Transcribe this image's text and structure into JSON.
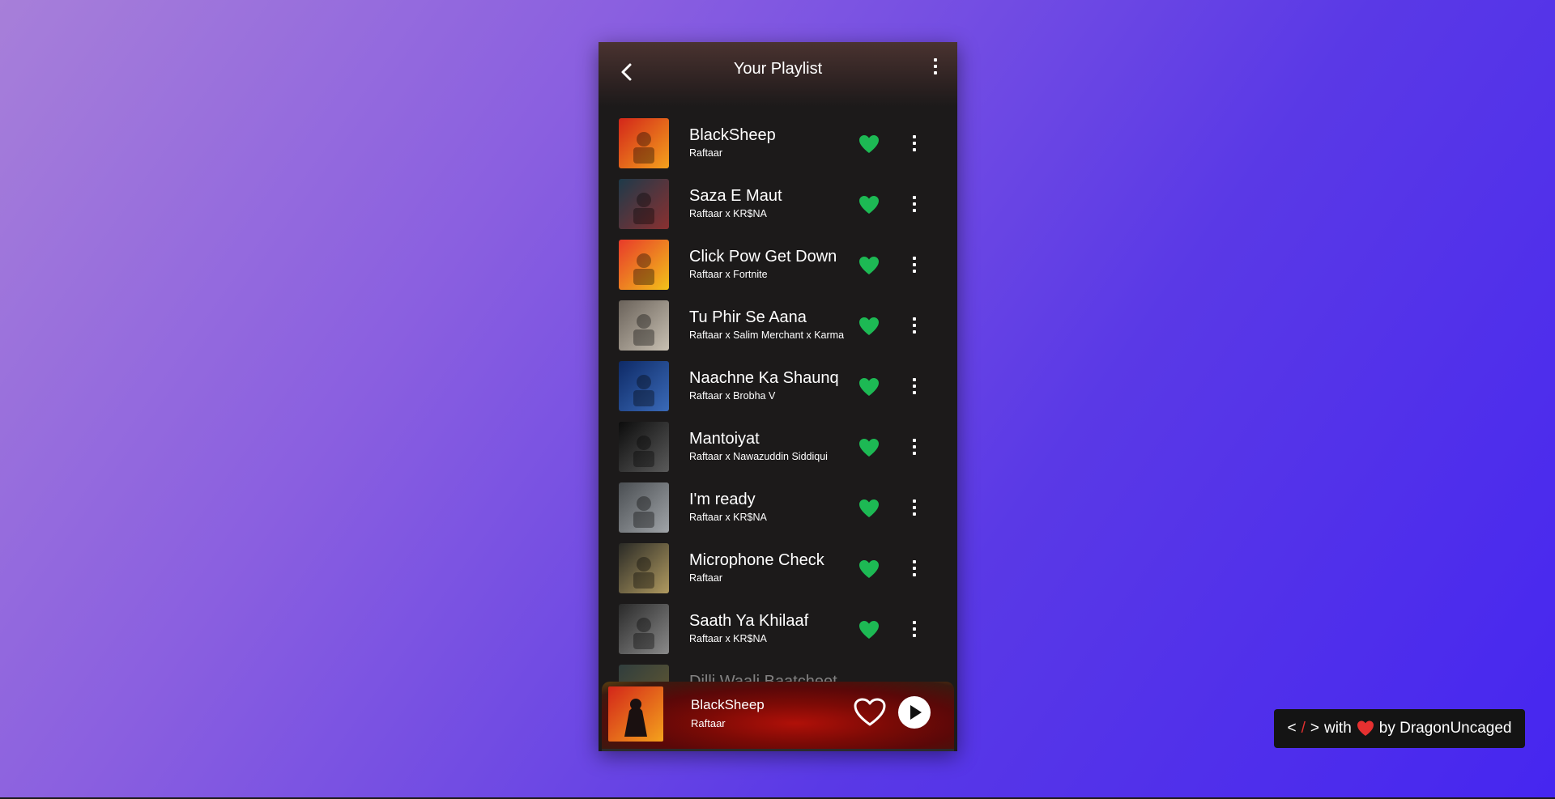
{
  "header": {
    "title": "Your Playlist",
    "back_icon": "chevron-left-icon",
    "more_icon": "more-vertical-icon"
  },
  "songs": [
    {
      "title": "BlackSheep",
      "artist": "Raftaar",
      "liked": true,
      "cover_colors": [
        "#d3261a",
        "#f4a21c"
      ]
    },
    {
      "title": "Saza E Maut",
      "artist": "Raftaar x KR$NA",
      "liked": true,
      "cover_colors": [
        "#1e3a4a",
        "#8a3030"
      ]
    },
    {
      "title": "Click Pow Get Down",
      "artist": "Raftaar x Fortnite",
      "liked": true,
      "cover_colors": [
        "#e83a2a",
        "#f2c21a"
      ]
    },
    {
      "title": "Tu Phir Se Aana",
      "artist": "Raftaar x Salim Merchant x Karma",
      "liked": true,
      "cover_colors": [
        "#6a625a",
        "#c8c0b2"
      ]
    },
    {
      "title": "Naachne Ka Shaunq",
      "artist": "Raftaar x Brobha V",
      "liked": true,
      "cover_colors": [
        "#0e2a66",
        "#3a6ab8"
      ]
    },
    {
      "title": "Mantoiyat",
      "artist": "Raftaar x Nawazuddin Siddiqui",
      "liked": true,
      "cover_colors": [
        "#0c0c0c",
        "#5a5a5a"
      ]
    },
    {
      "title": "I'm ready",
      "artist": "Raftaar x KR$NA",
      "liked": true,
      "cover_colors": [
        "#4a4e52",
        "#a0a4a8"
      ]
    },
    {
      "title": "Microphone Check",
      "artist": "Raftaar",
      "liked": true,
      "cover_colors": [
        "#2a2a26",
        "#b09a60"
      ]
    },
    {
      "title": "Saath Ya Khilaaf",
      "artist": "Raftaar x KR$NA",
      "liked": true,
      "cover_colors": [
        "#2a2a2a",
        "#8a8a8a"
      ]
    }
  ],
  "partial_row": {
    "title": "Dilli Waali Baatcheet",
    "cover_colors": [
      "#4a6a6a",
      "#c2a84a"
    ]
  },
  "player": {
    "title": "BlackSheep",
    "artist": "Raftaar",
    "heart_icon": "heart-outline-icon",
    "play_icon": "play-icon"
  },
  "credit": {
    "open": "<",
    "slash": "/",
    "close": ">",
    "with": "with",
    "by": "by DragonUncaged",
    "heart_icon": "heart-icon"
  },
  "colors": {
    "liked_heart": "#1db954",
    "credit_heart": "#e53030"
  }
}
